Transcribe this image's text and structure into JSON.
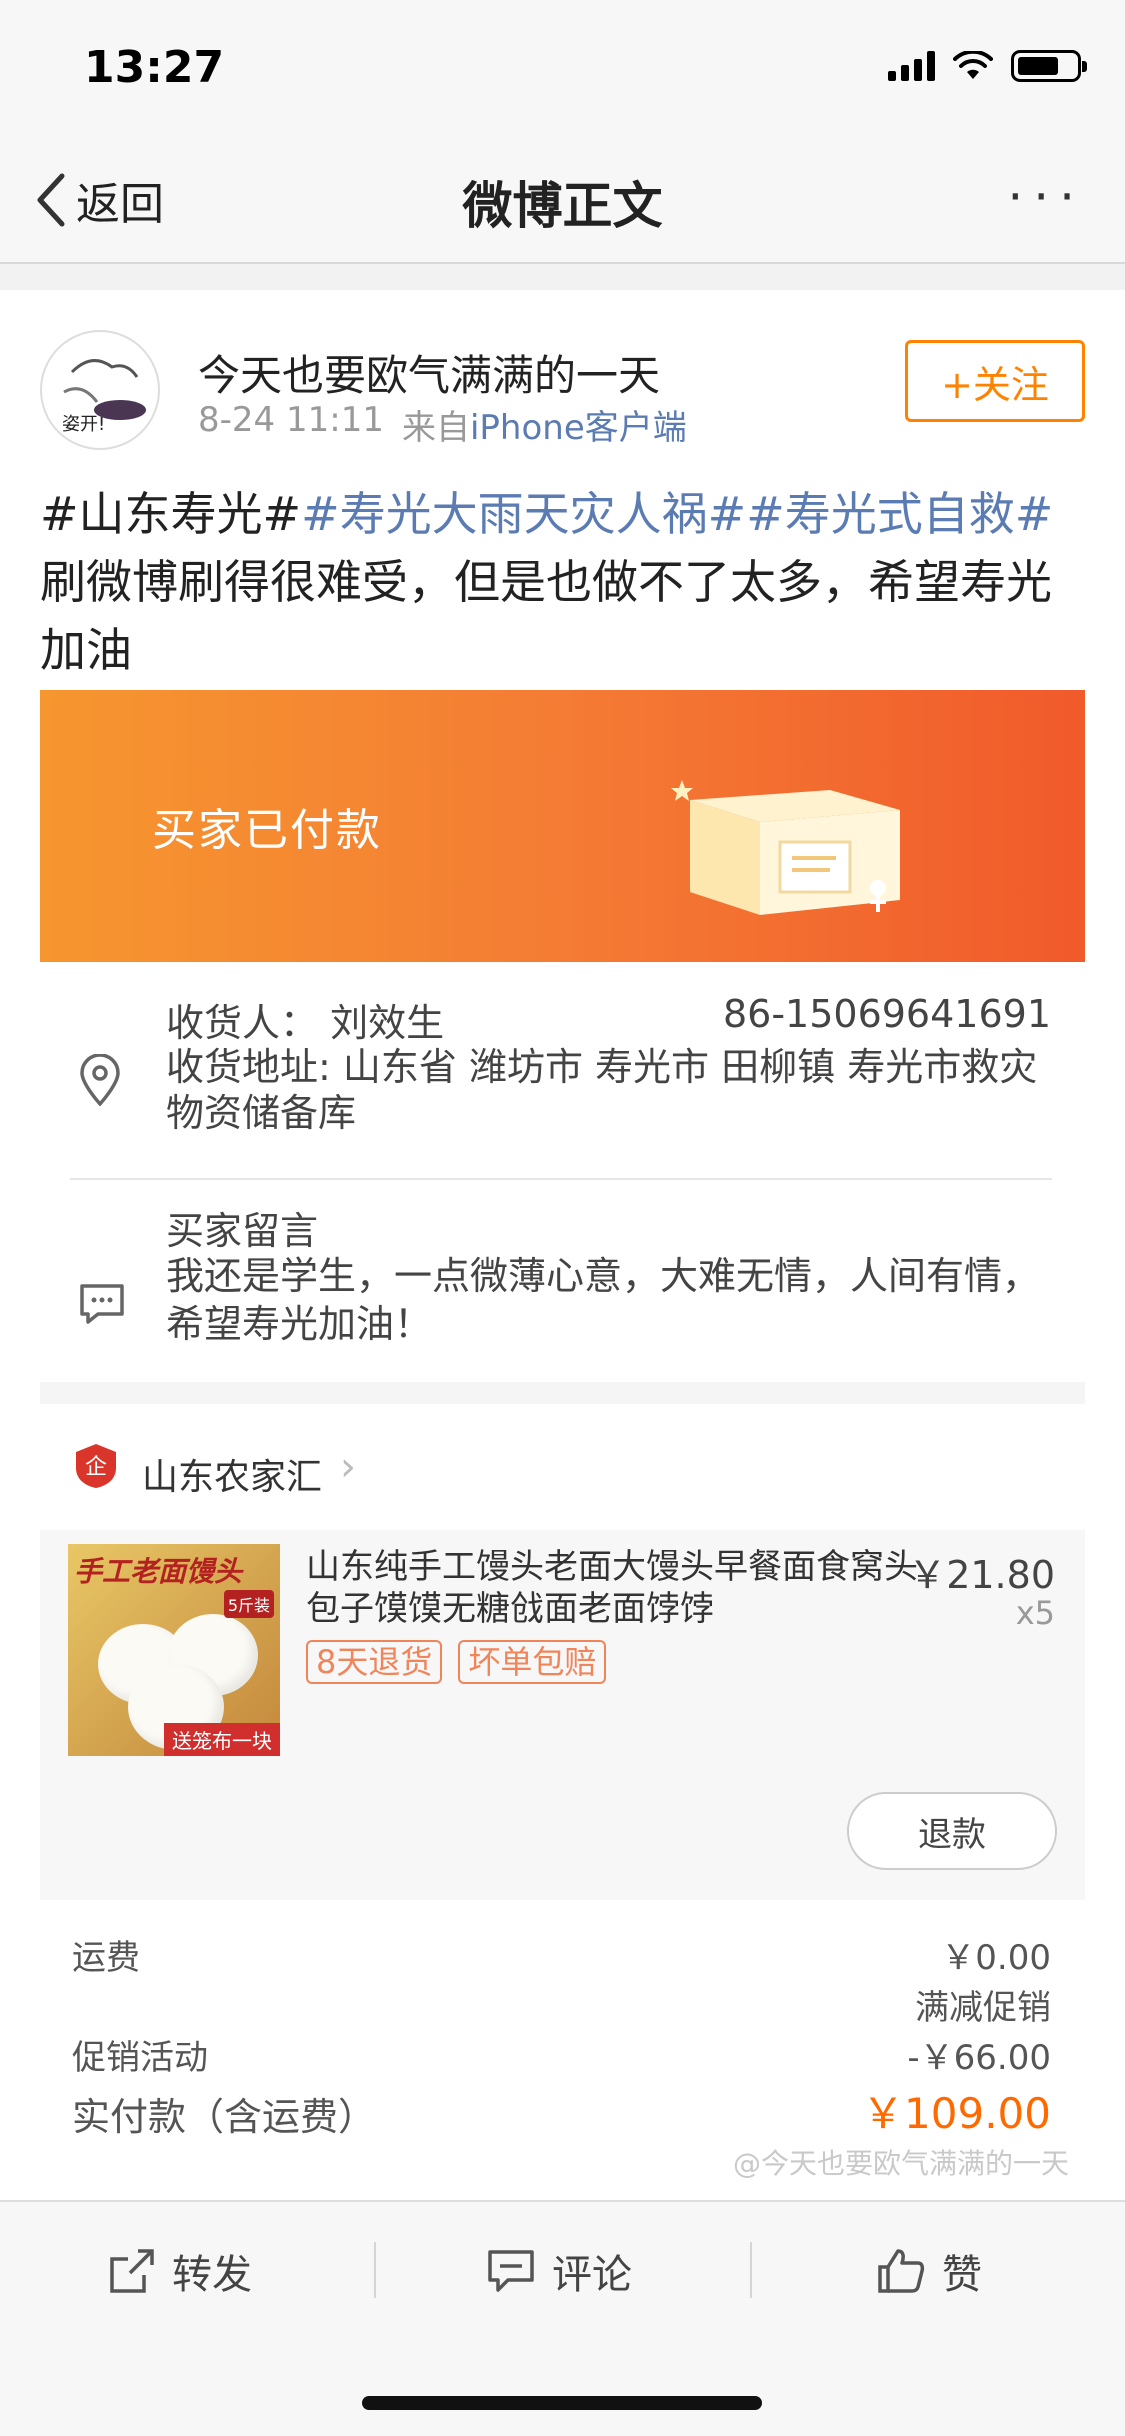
{
  "status_bar": {
    "time": "13:27"
  },
  "nav": {
    "back_label": "返回",
    "title": "微博正文",
    "more_label": "···"
  },
  "post": {
    "user_name": "今天也要欧气满满的一天",
    "avatar_text": "姿开!",
    "time": "8-24 11:11",
    "source_prefix": "来自",
    "source": "iPhone客户端",
    "follow_label": "+关注",
    "text_plain_1": "#山东寿光#",
    "hashtag_1": "#寿光大雨天灾人祸#",
    "hashtag_2": "#寿光式自救#",
    "text_plain_2": " 刷微博刷得很难受，但是也做不了太多，希望寿光加油",
    "emoji": "💪"
  },
  "order": {
    "status": "买家已付款",
    "consignee": "收货人：  刘效生",
    "phone": "86-15069641691",
    "address": "收货地址: 山东省 潍坊市 寿光市 田柳镇 寿光市救灾物资储备库",
    "message_label": "买家留言",
    "message_text": "我还是学生，一点微薄心意，大难无情，人间有情，希望寿光加油！",
    "shop_name": "山东农家汇",
    "product": {
      "title": "山东纯手工馒头老面大馒头早餐面食窝头包子馍馍无糖戗面老面饽饽",
      "price": "￥21.80",
      "qty": "x5",
      "tags": [
        "8天退货",
        "坏单包赔"
      ],
      "image_title": "手工老面馒头",
      "image_weight": "5斤装",
      "image_tag": "送笼布一块"
    },
    "refund_label": "退款",
    "shipping_label": "运费",
    "shipping_value": "￥0.00",
    "promo_name": "满减促销",
    "promo_label": "促销活动",
    "promo_value": "-￥66.00",
    "total_label": "实付款（含运费）",
    "total_value": "￥109.00"
  },
  "watermark": "@今天也要欧气满满的一天",
  "actions": {
    "repost": "转发",
    "comment": "评论",
    "like": "赞"
  }
}
